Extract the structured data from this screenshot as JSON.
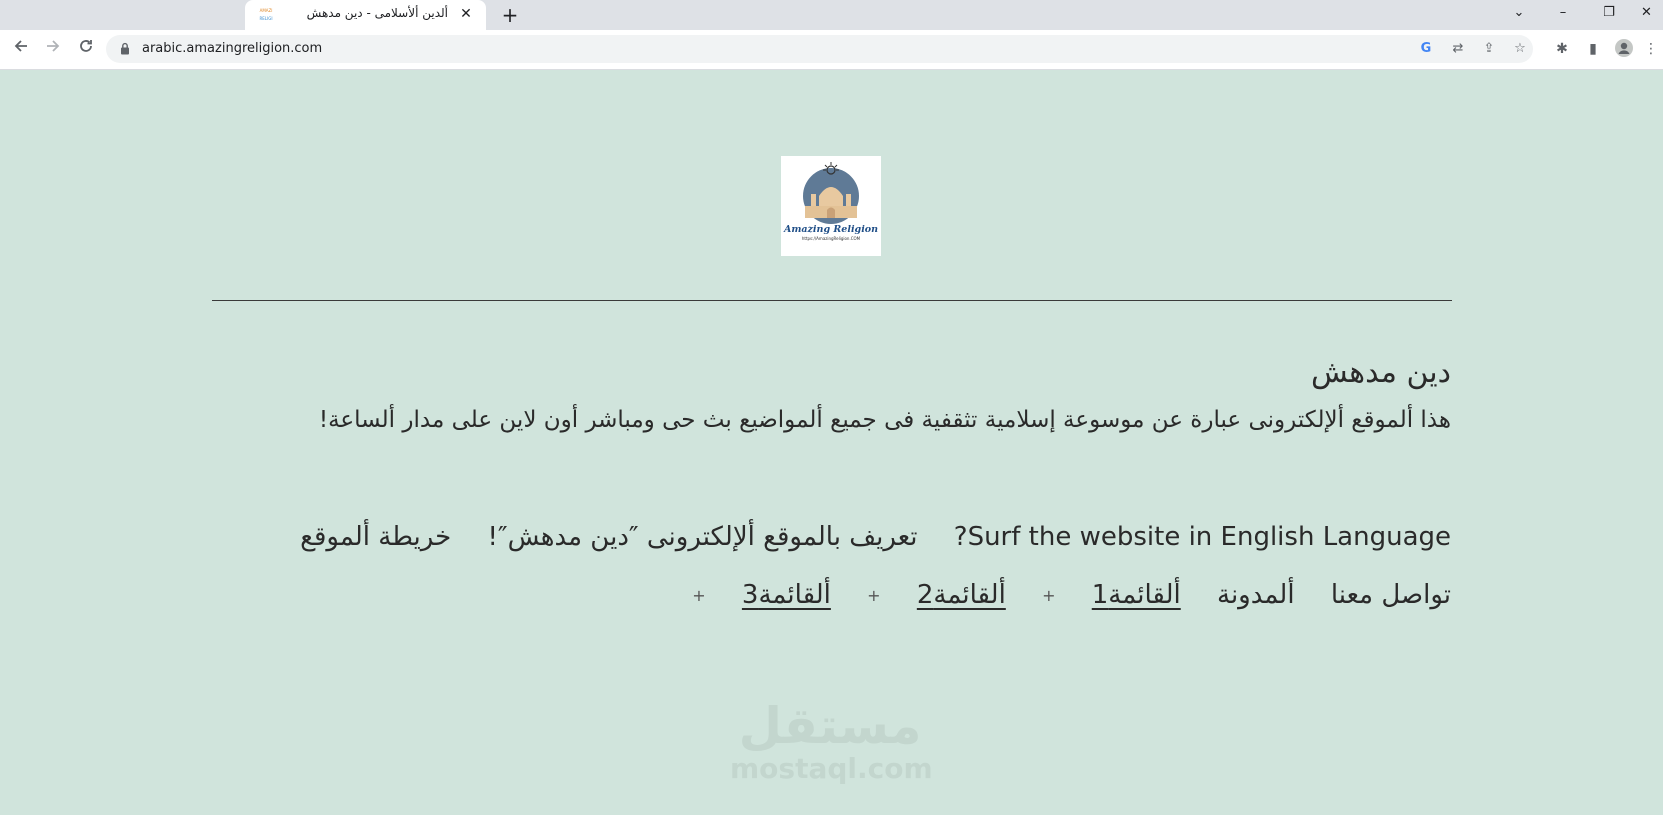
{
  "browser": {
    "tab": {
      "title": "ألدين ألأسلامى - دين مدهش",
      "favicon_line1": "AMAZI",
      "favicon_line2": "RELIGI"
    },
    "address": {
      "url": "arabic.amazingreligion.com"
    }
  },
  "page": {
    "logo": {
      "text": "Amazing Religion",
      "url": "https://AmazingReligion.COM"
    },
    "site_title": "دين مدهش",
    "site_description": "هذا ألموقع ألإلكترونى عبارة عن موسوعة إسلامية تثقفية فى جميع ألمواضيع بث حى ومباشر أون لاين على مدار ألساعة!",
    "nav_row1": [
      {
        "label": "Surf the website in English Language?"
      },
      {
        "label": "تعريف بالموقع ألإلكترونى ″دين مدهش″!"
      },
      {
        "label": "خريطة ألموقع"
      }
    ],
    "nav_row2": [
      {
        "label": "تواصل معنا"
      },
      {
        "label": "ألمدونة"
      },
      {
        "label": "ألقائمة1"
      },
      {
        "label": "ألقائمة2"
      },
      {
        "label": "ألقائمة3"
      }
    ],
    "plus_sign": "+",
    "watermark": {
      "arabic": "مستقل",
      "latin": "mostaql.com"
    }
  }
}
